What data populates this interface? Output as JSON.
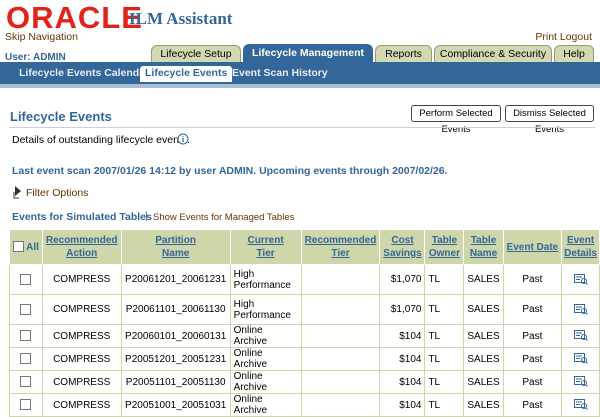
{
  "header": {
    "brand": "ORACLE",
    "app_name": "ILM Assistant",
    "skip_nav": "Skip Navigation",
    "print": "Print",
    "logout": "Logout",
    "user_label": "User: ADMIN"
  },
  "tabs": [
    "Lifecycle Setup",
    "Lifecycle Management",
    "Reports",
    "Compliance & Security",
    "Help"
  ],
  "subnav": [
    "Lifecycle Events Calendar",
    "Lifecycle Events",
    "Event Scan History"
  ],
  "page": {
    "title": "Lifecycle Events",
    "perform_btn": "Perform Selected Events",
    "dismiss_btn": "Dismiss Selected Events",
    "description": "Details of outstanding lifecycle events.",
    "scan_info": "Last event scan 2007/01/26 14:12 by user ADMIN.  Upcoming events through 2007/02/26.",
    "filter_options": "Filter Options",
    "events_title": "Events for Simulated Tables",
    "separator": "|",
    "show_managed": "Show Events for Managed Tables"
  },
  "table": {
    "headers": {
      "all": "All",
      "rec_action": [
        "Recommended",
        "Action"
      ],
      "partition": [
        "Partition",
        "Name"
      ],
      "current_tier": [
        "Current",
        "Tier"
      ],
      "rec_tier": [
        "Recommended",
        "Tier"
      ],
      "cost": [
        "Cost",
        "Savings"
      ],
      "owner": [
        "Table",
        "Owner"
      ],
      "tname": [
        "Table",
        "Name"
      ],
      "event_date": "Event Date",
      "event_details": [
        "Event",
        "Details"
      ]
    },
    "rows": [
      {
        "action": "COMPRESS",
        "partition": "P20061201_20061231",
        "tier": [
          "High",
          "Performance"
        ],
        "rec_tier": "",
        "cost": "$1,070",
        "owner": "TL",
        "table": "SALES",
        "date": "Past"
      },
      {
        "action": "COMPRESS",
        "partition": "P20061101_20061130",
        "tier": [
          "High",
          "Performance"
        ],
        "rec_tier": "",
        "cost": "$1,070",
        "owner": "TL",
        "table": "SALES",
        "date": "Past"
      },
      {
        "action": "COMPRESS",
        "partition": "P20060101_20060131",
        "tier": [
          "Online Archive"
        ],
        "rec_tier": "",
        "cost": "$104",
        "owner": "TL",
        "table": "SALES",
        "date": "Past"
      },
      {
        "action": "COMPRESS",
        "partition": "P20051201_20051231",
        "tier": [
          "Online Archive"
        ],
        "rec_tier": "",
        "cost": "$104",
        "owner": "TL",
        "table": "SALES",
        "date": "Past"
      },
      {
        "action": "COMPRESS",
        "partition": "P20051101_20051130",
        "tier": [
          "Online Archive"
        ],
        "rec_tier": "",
        "cost": "$104",
        "owner": "TL",
        "table": "SALES",
        "date": "Past"
      },
      {
        "action": "COMPRESS",
        "partition": "P20051001_20051031",
        "tier": [
          "Online Archive"
        ],
        "rec_tier": "",
        "cost": "$104",
        "owner": "TL",
        "table": "SALES",
        "date": "Past"
      }
    ]
  },
  "colors": {
    "brand_red": "#e2231a",
    "nav_blue": "#336699",
    "tab_olive": "#d2d8b0",
    "header_olive": "#cfd6a9",
    "link_brown": "#663300"
  }
}
